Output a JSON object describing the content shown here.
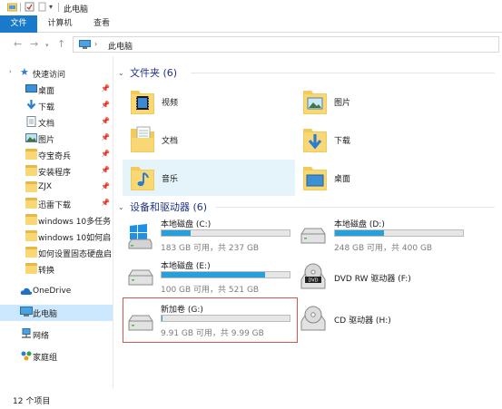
{
  "window": {
    "title": "此电脑"
  },
  "ribbon": {
    "tabs": [
      "文件",
      "计算机",
      "查看"
    ]
  },
  "address": {
    "path": "此电脑"
  },
  "nav": {
    "quick_access": "快速访问",
    "items": [
      {
        "label": "桌面",
        "icon": "desktop-icon",
        "pinned": true
      },
      {
        "label": "下载",
        "icon": "download-icon",
        "pinned": true
      },
      {
        "label": "文档",
        "icon": "documents-icon",
        "pinned": true
      },
      {
        "label": "图片",
        "icon": "pictures-icon",
        "pinned": true
      },
      {
        "label": "夺宝奇兵",
        "icon": "folder-icon",
        "pinned": true
      },
      {
        "label": "安装程序",
        "icon": "folder-icon",
        "pinned": true
      },
      {
        "label": "ZJX",
        "icon": "folder-icon",
        "pinned": true
      },
      {
        "label": "迅雷下载",
        "icon": "folder-icon",
        "pinned": true
      },
      {
        "label": "windows 10多任务",
        "icon": "folder-icon",
        "pinned": false
      },
      {
        "label": "windows 10如何启",
        "icon": "folder-icon",
        "pinned": false
      },
      {
        "label": "如何设置固态硬盘启",
        "icon": "folder-icon",
        "pinned": false
      },
      {
        "label": "转换",
        "icon": "folder-icon",
        "pinned": false
      }
    ],
    "onedrive": "OneDrive",
    "thispc": "此电脑",
    "network": "网络",
    "homegroup": "家庭组"
  },
  "folders": {
    "header": "文件夹 (6)",
    "items": [
      {
        "label": "视频",
        "icon": "videos-folder-icon"
      },
      {
        "label": "图片",
        "icon": "pictures-folder-icon"
      },
      {
        "label": "文档",
        "icon": "documents-folder-icon"
      },
      {
        "label": "下载",
        "icon": "downloads-folder-icon"
      },
      {
        "label": "音乐",
        "icon": "music-folder-icon"
      },
      {
        "label": "桌面",
        "icon": "desktop-folder-icon"
      }
    ]
  },
  "drives": {
    "header": "设备和驱动器 (6)",
    "items": [
      {
        "label": "本地磁盘 (C:)",
        "info": "183 GB 可用，共 237 GB",
        "used_fraction": 0.23,
        "icon": "windows-drive-icon"
      },
      {
        "label": "本地磁盘 (D:)",
        "info": "248 GB 可用，共 400 GB",
        "used_fraction": 0.38,
        "icon": "hard-drive-icon"
      },
      {
        "label": "本地磁盘 (E:)",
        "info": "100 GB 可用，共 521 GB",
        "used_fraction": 0.81,
        "icon": "hard-drive-icon"
      },
      {
        "label": "DVD RW 驱动器 (F:)",
        "info": "",
        "icon": "dvd-drive-icon"
      },
      {
        "label": "新加卷 (G:)",
        "info": "9.91 GB 可用，共 9.99 GB",
        "used_fraction": 0.01,
        "icon": "hard-drive-icon"
      },
      {
        "label": "CD 驱动器 (H:)",
        "info": "",
        "icon": "cd-drive-icon"
      }
    ]
  },
  "status": {
    "count": "12 个项目"
  },
  "colors": {
    "accent": "#1979ca",
    "bar_fill": "#26a0da",
    "highlight_box": "#d9534f",
    "selection": "#cce8ff"
  }
}
